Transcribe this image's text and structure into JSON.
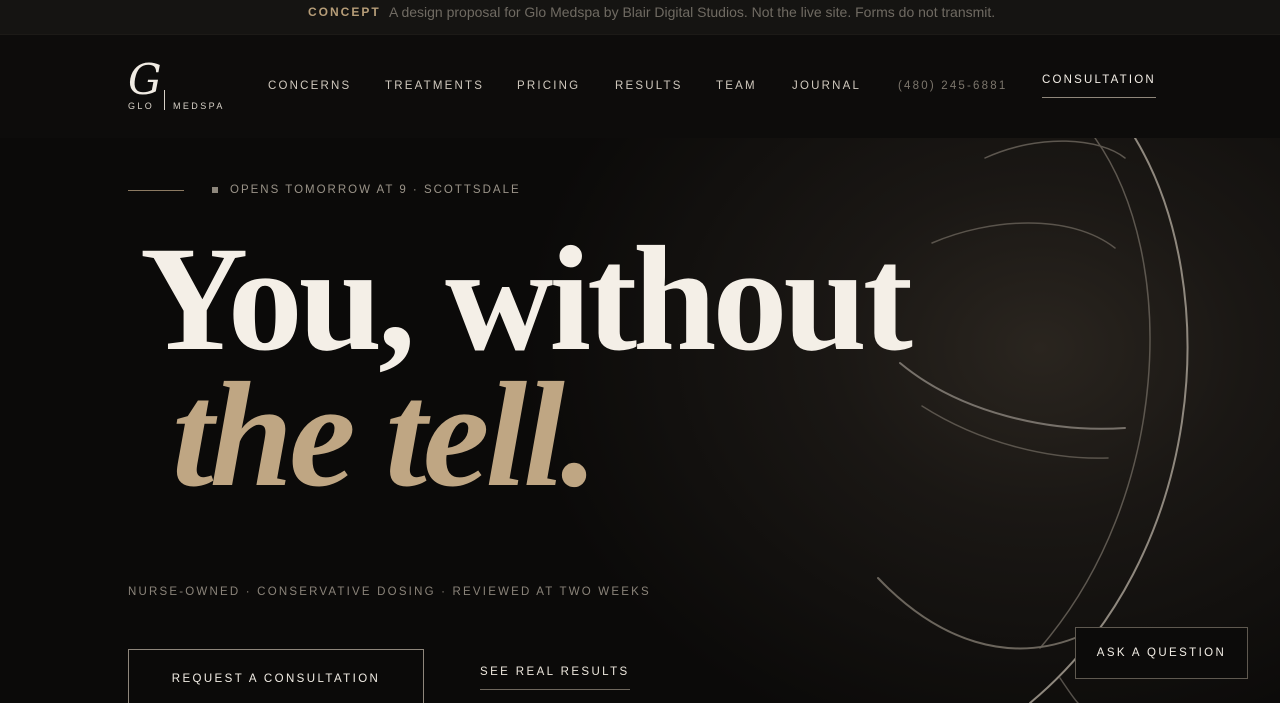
{
  "banner": {
    "tag": "CONCEPT",
    "text": "A design proposal for Glo Medspa by Blair Digital Studios. Not the live site. Forms do not transmit."
  },
  "brand": {
    "mark": "G",
    "left_word": "GLO",
    "right_word": "MEDSPA"
  },
  "nav": {
    "items": [
      {
        "label": "CONCERNS"
      },
      {
        "label": "TREATMENTS"
      },
      {
        "label": "PRICING"
      },
      {
        "label": "RESULTS"
      },
      {
        "label": "TEAM"
      },
      {
        "label": "JOURNAL"
      }
    ],
    "phone": "(480) 245-6881",
    "cta": "CONSULTATION"
  },
  "hero": {
    "eyebrow": "OPENS TOMORROW AT 9 · SCOTTSDALE",
    "headline_line1": "You, without",
    "headline_line2": "the tell.",
    "proof": "NURSE-OWNED · CONSERVATIVE DOSING · REVIEWED AT TWO WEEKS",
    "primary_cta": "REQUEST A CONSULTATION",
    "secondary_cta": "SEE REAL RESULTS"
  },
  "floating": {
    "ask": "ASK A QUESTION"
  },
  "colors": {
    "background": "#0b0a09",
    "accent_gold": "#bfa683",
    "text_light": "#f4efe7"
  }
}
